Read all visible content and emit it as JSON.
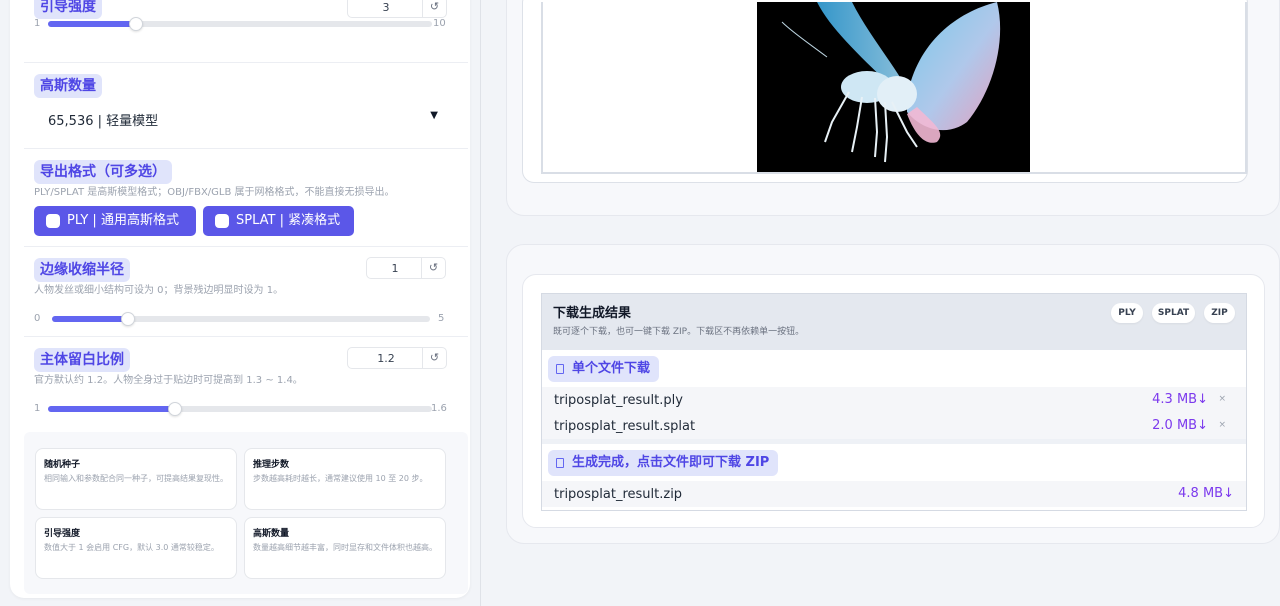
{
  "left": {
    "guidance": {
      "label": "引导强度",
      "value": "3",
      "min": "1",
      "max": "10",
      "level": 0.23
    },
    "gaussians": {
      "label": "高斯数量",
      "selected": "65,536 | 轻量模型"
    },
    "export": {
      "label": "导出格式（可多选）",
      "hint": "PLY/SPLAT 是高斯模型格式；OBJ/FBX/GLB 属于网格格式，不能直接无损导出。",
      "options": [
        "PLY | 通用高斯格式",
        "SPLAT | 紧凑格式"
      ]
    },
    "edge": {
      "label": "边缘收缩半径",
      "value": "1",
      "hint": "人物发丝或细小结构可设为 0；背景残边明显时设为 1。",
      "min": "0",
      "max": "5",
      "level": 0.2
    },
    "margin": {
      "label": "主体留白比例",
      "value": "1.2",
      "hint": "官方默认约 1.2。人物全身过于贴边时可提高到 1.3 ~ 1.4。",
      "min": "1",
      "max": "1.6",
      "level": 0.33
    },
    "cards": [
      {
        "title": "随机种子",
        "desc": "相同输入和参数配合同一种子，可提高结果复现性。"
      },
      {
        "title": "推理步数",
        "desc": "步数越高耗时越长，通常建议使用 10 至 20 步。"
      },
      {
        "title": "引导强度",
        "desc": "数值大于 1 会启用 CFG，默认 3.0 通常较稳定。"
      },
      {
        "title": "高斯数量",
        "desc": "数量越高细节越丰富，同时显存和文件体积也越高。"
      }
    ],
    "reset_symbol": "↺"
  },
  "download": {
    "title": "下载生成结果",
    "subtitle": "既可逐个下载，也可一键下载 ZIP。下载区不再依赖单一按钮。",
    "formats": [
      "PLY",
      "SPLAT",
      "ZIP"
    ],
    "single_label": "单个文件下载",
    "files": [
      {
        "name": "triposplat_result.ply",
        "size": "4.3 MB↓",
        "close": "×"
      },
      {
        "name": "triposplat_result.splat",
        "size": "2.0 MB↓",
        "close": "×"
      }
    ],
    "zip_label": "生成完成，点击文件即可下载 ZIP",
    "zip_file": {
      "name": "triposplat_result.zip",
      "size": "4.8 MB↓"
    }
  },
  "colors": {
    "accent": "#5b57e8",
    "chip_bg": "#e0e4fb",
    "size_text": "#7c3aed"
  }
}
